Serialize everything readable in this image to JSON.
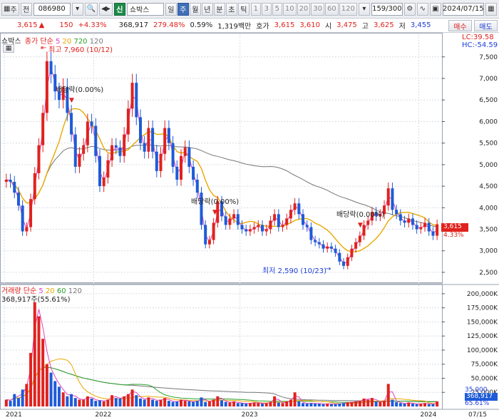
{
  "toolbar": {
    "menu_label": "주",
    "market_label": "전",
    "stock_code": "086980",
    "market_badge": "신",
    "stock_name": "쇼박스",
    "periods": [
      "일",
      "주",
      "월",
      "년",
      "분",
      "초",
      "틱"
    ],
    "active_period": "주",
    "intervals": [
      "1",
      "3",
      "5",
      "10",
      "20",
      "30",
      "60",
      "120"
    ],
    "count": "159",
    "total": "/300",
    "date": "2024/07/15"
  },
  "quote": {
    "price": "3,615",
    "change": "150",
    "change_pct": "+4.33%",
    "volume": "368,917",
    "volume_ratio": "279.48%",
    "turnover": "0.59%",
    "amount": "1,319백만",
    "ask_label": "호가",
    "ask1": "3,615",
    "ask2": "3,610",
    "open_label": "시",
    "open": "3,475",
    "high_label": "고",
    "high": "3,625",
    "low_label": "저",
    "low": "3,455",
    "buy_button": "매수",
    "sell_button": "매도"
  },
  "price_panel": {
    "title": "쇼박스",
    "legend_prefix": "종가 단순",
    "ma_periods": [
      "5",
      "20",
      "720",
      "120"
    ],
    "lc_label": "LC:39.58",
    "hc_label": "HC:-54.59",
    "max_annotation": "최고 7,960 (10/12)",
    "min_annotation": "최저 2,590 (10/23)",
    "dividend_label": "배당락(0.00%)",
    "last_price": "3,615",
    "last_pct": "4.33%"
  },
  "volume_panel": {
    "legend_prefix": "거래량 단순",
    "ma_periods": [
      "5",
      "20",
      "60",
      "120"
    ],
    "value_label": "368,917주(55.61%)",
    "right_value": "368,917",
    "right_ma": "35,000",
    "right_pct": "65.61%"
  },
  "x_axis": {
    "labels": [
      "2021",
      "2022",
      "2023",
      "2024",
      "07/15"
    ]
  },
  "colors": {
    "up": "#e0221e",
    "down": "#1e5bd8",
    "ma5": "#e040c0",
    "ma20": "#e8a800",
    "ma120": "#777777",
    "vol_ma60": "#2aa02a"
  },
  "chart_data": {
    "type": "candlestick",
    "price_y_ticks": [
      7500,
      7000,
      6500,
      6000,
      5500,
      5000,
      4500,
      4000,
      3500,
      3000,
      2500
    ],
    "price_ylim": [
      2300,
      7960
    ],
    "volume_y_ticks": [
      "200,000K",
      "175,000K",
      "150,000K",
      "125,000K",
      "100,000K",
      "75,000K",
      "50,000K",
      "25,000K"
    ],
    "volume_ylim": [
      0,
      210000
    ],
    "x_labels": [
      "2021",
      "2022",
      "2023",
      "2024",
      "07/15"
    ],
    "close_series": [
      4650,
      4600,
      4350,
      4050,
      3450,
      3550,
      4200,
      4800,
      5450,
      6200,
      7400,
      7100,
      6700,
      6500,
      6800,
      6200,
      5700,
      4950,
      5250,
      5450,
      6000,
      5900,
      5200,
      4500,
      4700,
      5100,
      5450,
      5400,
      5200,
      5700,
      6300,
      6900,
      6100,
      5500,
      5300,
      5850,
      5300,
      4850,
      5250,
      5850,
      5500,
      4950,
      4650,
      5200,
      5400,
      4950,
      4650,
      4350,
      3600,
      3150,
      3250,
      3650,
      4150,
      3800,
      3600,
      3750,
      3850,
      3600,
      3500,
      3450,
      3500,
      3550,
      3600,
      3450,
      3500,
      3700,
      3850,
      3550,
      3600,
      3750,
      3950,
      4100,
      3850,
      3600,
      3550,
      3250,
      3200,
      3150,
      3050,
      3100,
      3050,
      2950,
      2750,
      2650,
      2850,
      3050,
      3200,
      3350,
      3600,
      3700,
      3900,
      3800,
      3850,
      4050,
      4450,
      3950,
      3850,
      3700,
      3650,
      3750,
      3600,
      3500,
      3550,
      3650,
      3450,
      3350,
      3615
    ],
    "volume_series": [
      12000,
      10000,
      22000,
      15000,
      30000,
      40000,
      95000,
      185000,
      160000,
      120000,
      75000,
      60000,
      45000,
      35000,
      25000,
      18000,
      22000,
      15000,
      12000,
      12000,
      18000,
      14000,
      10000,
      11000,
      9000,
      12000,
      20000,
      15000,
      14000,
      18000,
      22000,
      30000,
      20000,
      14000,
      12000,
      16000,
      12000,
      10000,
      12000,
      15000,
      10000,
      8000,
      9000,
      12000,
      10000,
      9000,
      8000,
      10000,
      16000,
      8000,
      9000,
      12000,
      18000,
      11000,
      8000,
      7000,
      9000,
      6000,
      6000,
      5000,
      6000,
      7000,
      6000,
      5000,
      6000,
      8000,
      18000,
      7000,
      6000,
      9000,
      12000,
      25000,
      9000,
      6000,
      5000,
      6000,
      5000,
      5000,
      4000,
      5000,
      4000,
      4000,
      5000,
      6000,
      7000,
      8000,
      9000,
      10000,
      14000,
      12000,
      15000,
      9000,
      8000,
      10000,
      40000,
      12000,
      8000,
      6000,
      5000,
      7000,
      5000,
      4000,
      5000,
      6000,
      4000,
      4000,
      9000
    ]
  }
}
